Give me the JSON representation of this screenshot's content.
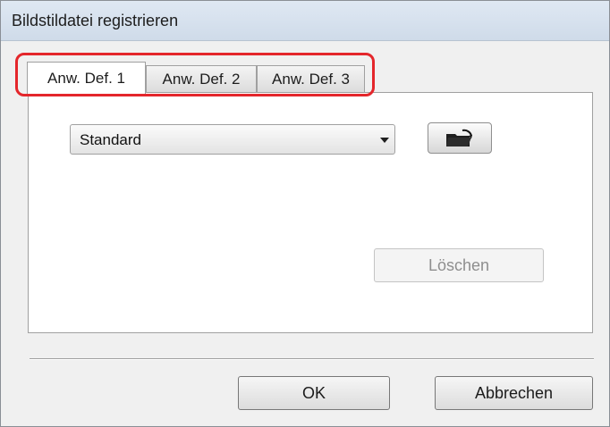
{
  "window": {
    "title": "Bildstildatei registrieren"
  },
  "tabs": [
    {
      "label": "Anw. Def. 1",
      "selected": true
    },
    {
      "label": "Anw. Def. 2",
      "selected": false
    },
    {
      "label": "Anw. Def. 3",
      "selected": false
    }
  ],
  "panel": {
    "style_select": {
      "value": "Standard"
    },
    "open_file_button": {
      "icon": "open-folder-icon"
    },
    "delete_button": {
      "label": "Löschen",
      "enabled": false
    }
  },
  "footer": {
    "ok_label": "OK",
    "cancel_label": "Abbrechen"
  },
  "colors": {
    "highlight": "#e4262b",
    "titlebar": "#dfe8f3",
    "dialog_background": "#f0f0f0"
  }
}
